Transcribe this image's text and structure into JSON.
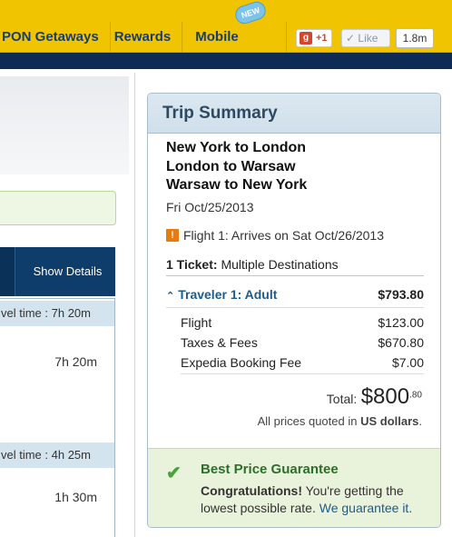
{
  "navbar": {
    "items": [
      "PON Getaways",
      "Rewards",
      "Mobile"
    ],
    "new_badge": "NEW",
    "gplus_label": "+1",
    "gplus_icon": "google-plus-icon",
    "like_label": "Like",
    "like_count": "1.8m"
  },
  "left": {
    "show_details": "Show Details",
    "travel_rows": [
      "vel time : 7h 20m",
      "vel time : 4h 25m"
    ],
    "durations": [
      "7h 20m",
      "1h 30m"
    ]
  },
  "trip": {
    "title": "Trip Summary",
    "routes": [
      "New York to London",
      "London to Warsaw",
      "Warsaw to New York"
    ],
    "date": "Fri Oct/25/2013",
    "warning": "Flight 1: Arrives on Sat Oct/26/2013",
    "ticket_label": "1 Ticket:",
    "ticket_value": "Multiple Destinations",
    "traveler_label": "Traveler 1: Adult",
    "traveler_amount": "$793.80",
    "lines": [
      {
        "label": "Flight",
        "amount": "$123.00"
      },
      {
        "label": "Taxes & Fees",
        "amount": "$670.80"
      },
      {
        "label": "Expedia Booking Fee",
        "amount": "$7.00"
      }
    ],
    "total_label": "Total:",
    "total_int": "$800",
    "total_dec": ".80",
    "prices_note_pre": "All prices quoted in",
    "prices_note_bold": "US dollars",
    "prices_note_post": "."
  },
  "guarantee": {
    "title": "Best Price Guarantee",
    "bold": "Congratulations!",
    "text": " You're getting the lowest possible rate.",
    "link": "We guarantee it."
  },
  "colors": {
    "nav_yellow": "#f0c400",
    "navy": "#0d2b55",
    "link_blue": "#1f5a8c",
    "green": "#2d6e2a"
  }
}
